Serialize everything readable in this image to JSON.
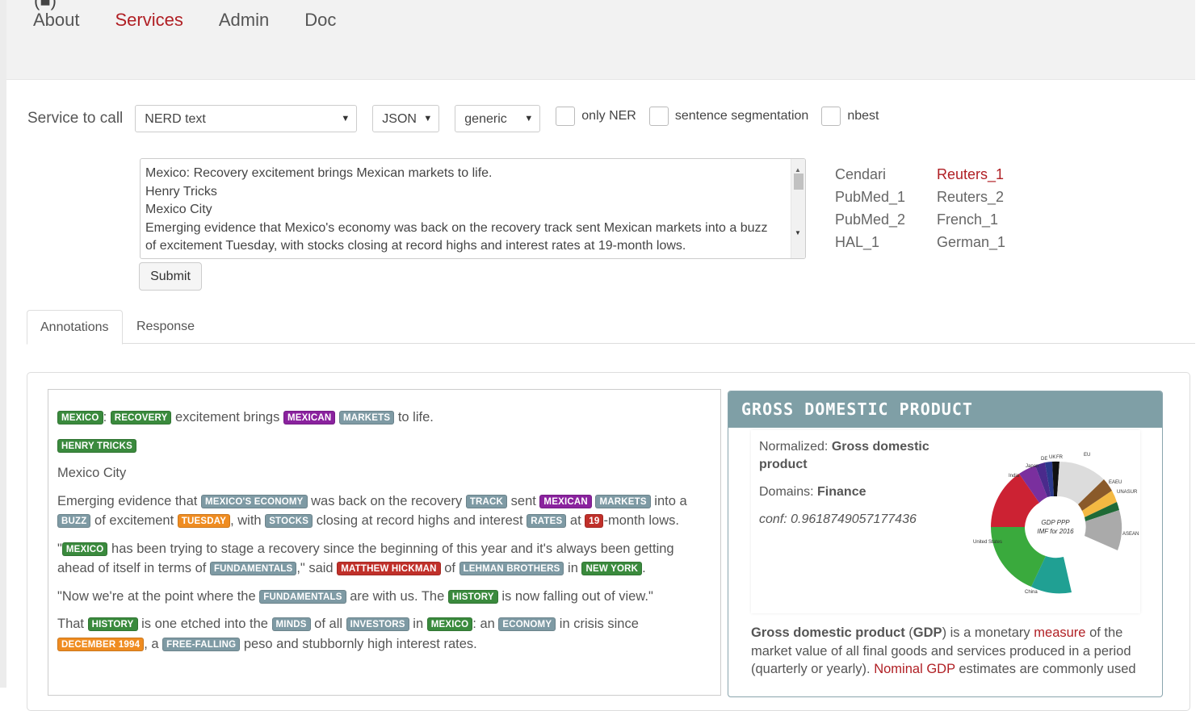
{
  "nav": {
    "brand_fragment": "(■)",
    "links": [
      "About",
      "Services",
      "Admin",
      "Doc"
    ],
    "active": "Services"
  },
  "controls": {
    "service_label": "Service to call",
    "service_value": "NERD text",
    "format_value": "JSON",
    "mode_value": "generic",
    "checkboxes": [
      {
        "label": "only NER",
        "checked": false
      },
      {
        "label": "sentence segmentation",
        "checked": false
      },
      {
        "label": "nbest",
        "checked": false
      }
    ]
  },
  "input_text": {
    "lines": [
      "Mexico: Recovery excitement brings Mexican markets to life.",
      "Henry Tricks",
      "Mexico City",
      "Emerging evidence that Mexico's economy was back on the recovery track sent Mexican markets into a buzz",
      "of excitement Tuesday, with stocks closing at record highs and interest rates at 19-month lows."
    ]
  },
  "submit_label": "Submit",
  "examples": {
    "col1": [
      "Cendari",
      "PubMed_1",
      "PubMed_2",
      "HAL_1"
    ],
    "col2": [
      "Reuters_1",
      "Reuters_2",
      "French_1",
      "German_1"
    ],
    "selected": "Reuters_1"
  },
  "tabs": [
    "Annotations",
    "Response"
  ],
  "annotated": {
    "p1": {
      "t1": ": ",
      "t2": " excitement brings ",
      "t3": " to life.",
      "e1": "MEXICO",
      "e2": "RECOVERY",
      "e3": "MEXICAN",
      "e4": "MARKETS"
    },
    "p2": {
      "e1": "HENRY TRICKS"
    },
    "p3": {
      "t1": "Mexico City"
    },
    "p4": {
      "t1": "Emerging evidence that ",
      "e1": "MEXICO'S ECONOMY",
      "t2": " was back on the recovery ",
      "e2": "TRACK",
      "t3": " sent ",
      "e3": "MEXICAN",
      "t4": " ",
      "e4": "MARKETS",
      "t5": " into a ",
      "e5": "BUZZ",
      "t6": " of excitement ",
      "e6": "TUESDAY",
      "t7": ", with ",
      "e7": "STOCKS",
      "t8": " closing at record highs and interest ",
      "e8": "RATES",
      "t9": " at ",
      "e9": "19",
      "t10": "-month lows."
    },
    "p5": {
      "t1": "\"",
      "e1": "MEXICO",
      "t2": " has been trying to stage a recovery since the beginning of this year and it's always been getting ahead of itself in terms of ",
      "e2": "FUNDAMENTALS",
      "t3": ",\" said ",
      "e3": "MATTHEW HICKMAN",
      "t4": " of ",
      "e4": "LEHMAN BROTHERS",
      "t5": " in ",
      "e5": "NEW YORK",
      "t6": "."
    },
    "p6": {
      "t1": "\"Now we're at the point where the ",
      "e1": "FUNDAMENTALS",
      "t2": " are with us. The ",
      "e2": "HISTORY",
      "t3": " is now falling out of view.\""
    },
    "p7": {
      "t1": "That ",
      "e1": "HISTORY",
      "t2": " is one etched into the ",
      "e2": "MINDS",
      "t3": " of all ",
      "e3": "INVESTORS",
      "t4": " in ",
      "e4": "MEXICO",
      "t5": ": an ",
      "e5": "ECONOMY",
      "t6": " in crisis since ",
      "e6": "DECEMBER 1994",
      "t7": ", a ",
      "e7": "FREE-FALLING",
      "t8": " peso and stubbornly high interest rates."
    }
  },
  "info": {
    "title": "GROSS DOMESTIC PRODUCT",
    "normalized_label": "Normalized: ",
    "normalized_value": "Gross domestic product",
    "domains_label": "Domains: ",
    "domains_value": "Finance",
    "conf_label": "conf: ",
    "conf_value": "0.9618749057177436",
    "chart_center_1": "GDP PPP",
    "chart_center_2": "IMF for 2016",
    "chart_labels": [
      "India",
      "Japan",
      "DE",
      "UK",
      "FR",
      "EU",
      "EAEU",
      "UNASUR",
      "ASEAN",
      "United States",
      "China"
    ],
    "def": {
      "b1": "Gross domestic product",
      "t1": " (",
      "b2": "GDP",
      "t2": ") is a monetary ",
      "a1": "measure",
      "t3": " of the market value of all final goods and services produced in a period (quarterly or yearly). ",
      "a2": "Nominal GDP",
      "t4": " estimates are commonly used"
    }
  },
  "colors": {
    "accent": "#b01f24",
    "header_bg": "#7f9fa6",
    "entity_green": "#3a8a3d",
    "entity_purple": "#8a229e",
    "entity_gray": "#7e9aa4",
    "entity_red": "#c0302a",
    "entity_orange": "#ef8c21"
  }
}
